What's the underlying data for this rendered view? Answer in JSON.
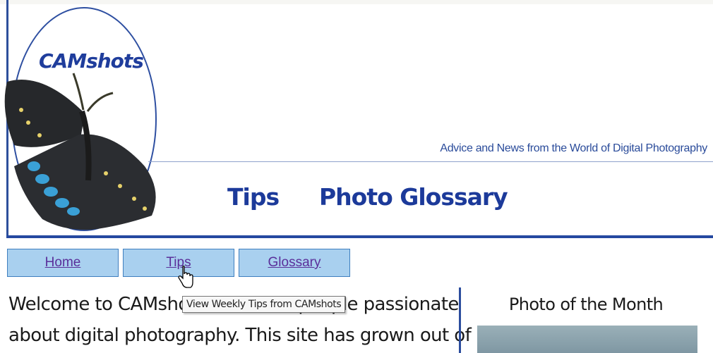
{
  "header": {
    "logo_text": "CAMshots",
    "tagline": "Advice and News from the World of Digital Photography",
    "links": [
      "Tips",
      "Photo Glossary"
    ]
  },
  "nav": {
    "home": "Home",
    "tips": "Tips",
    "glossary": "Glossary"
  },
  "tooltip": "View Weekly Tips from CAMshots",
  "main": {
    "welcome_line1": "Welcome to CAMshots, a site for people passionate",
    "welcome_line2": "about digital photography. This site has grown out of"
  },
  "sidebar": {
    "photo_of_month_title": "Photo of the Month"
  },
  "colors": {
    "brand_blue": "#1c3a9a",
    "nav_button_bg": "#a9d0ef",
    "nav_link": "#5a2f9a"
  },
  "icons": {
    "cursor": "hand-pointer-icon",
    "logo": "butterfly-logo"
  }
}
